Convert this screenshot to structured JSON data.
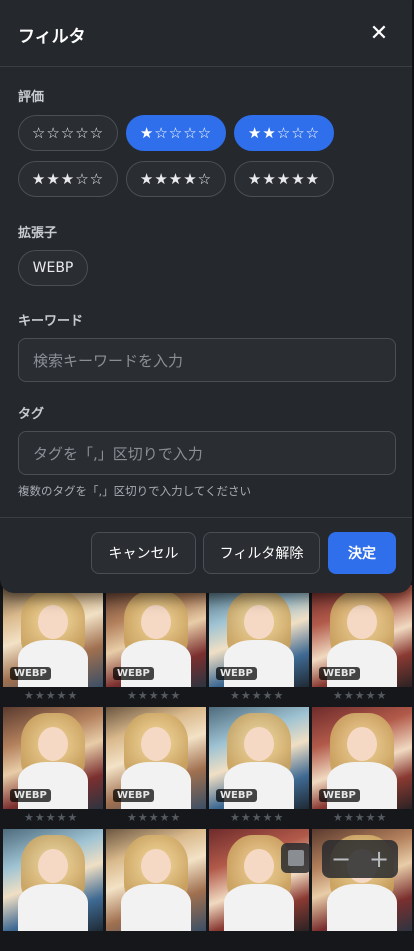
{
  "modal": {
    "title": "フィルタ",
    "sections": {
      "rating_label": "評価",
      "extension_label": "拡張子",
      "keyword_label": "キーワード",
      "tag_label": "タグ"
    },
    "ratings": [
      {
        "label": "☆☆☆☆☆",
        "active": false
      },
      {
        "label": "★☆☆☆☆",
        "active": true
      },
      {
        "label": "★★☆☆☆",
        "active": true
      },
      {
        "label": "★★★☆☆",
        "active": false
      },
      {
        "label": "★★★★☆",
        "active": false
      },
      {
        "label": "★★★★★",
        "active": false
      }
    ],
    "extensions": [
      "WEBP"
    ],
    "keyword_placeholder": "検索キーワードを入力",
    "tag_placeholder": "タグを「,」区切りで入力",
    "tag_hint": "複数のタグを「,」区切りで入力してください",
    "buttons": {
      "cancel": "キャンセル",
      "clear": "フィルタ解除",
      "apply": "決定"
    }
  },
  "gallery": {
    "badge": "WEBP",
    "stars": "★★★★★",
    "rows": 3,
    "cols": 4
  },
  "controls": {
    "zoom_out": "−",
    "zoom_in": "+"
  },
  "colors": {
    "accent": "#2f6fec",
    "modal_bg": "#25282d",
    "page_bg": "#15171a"
  }
}
